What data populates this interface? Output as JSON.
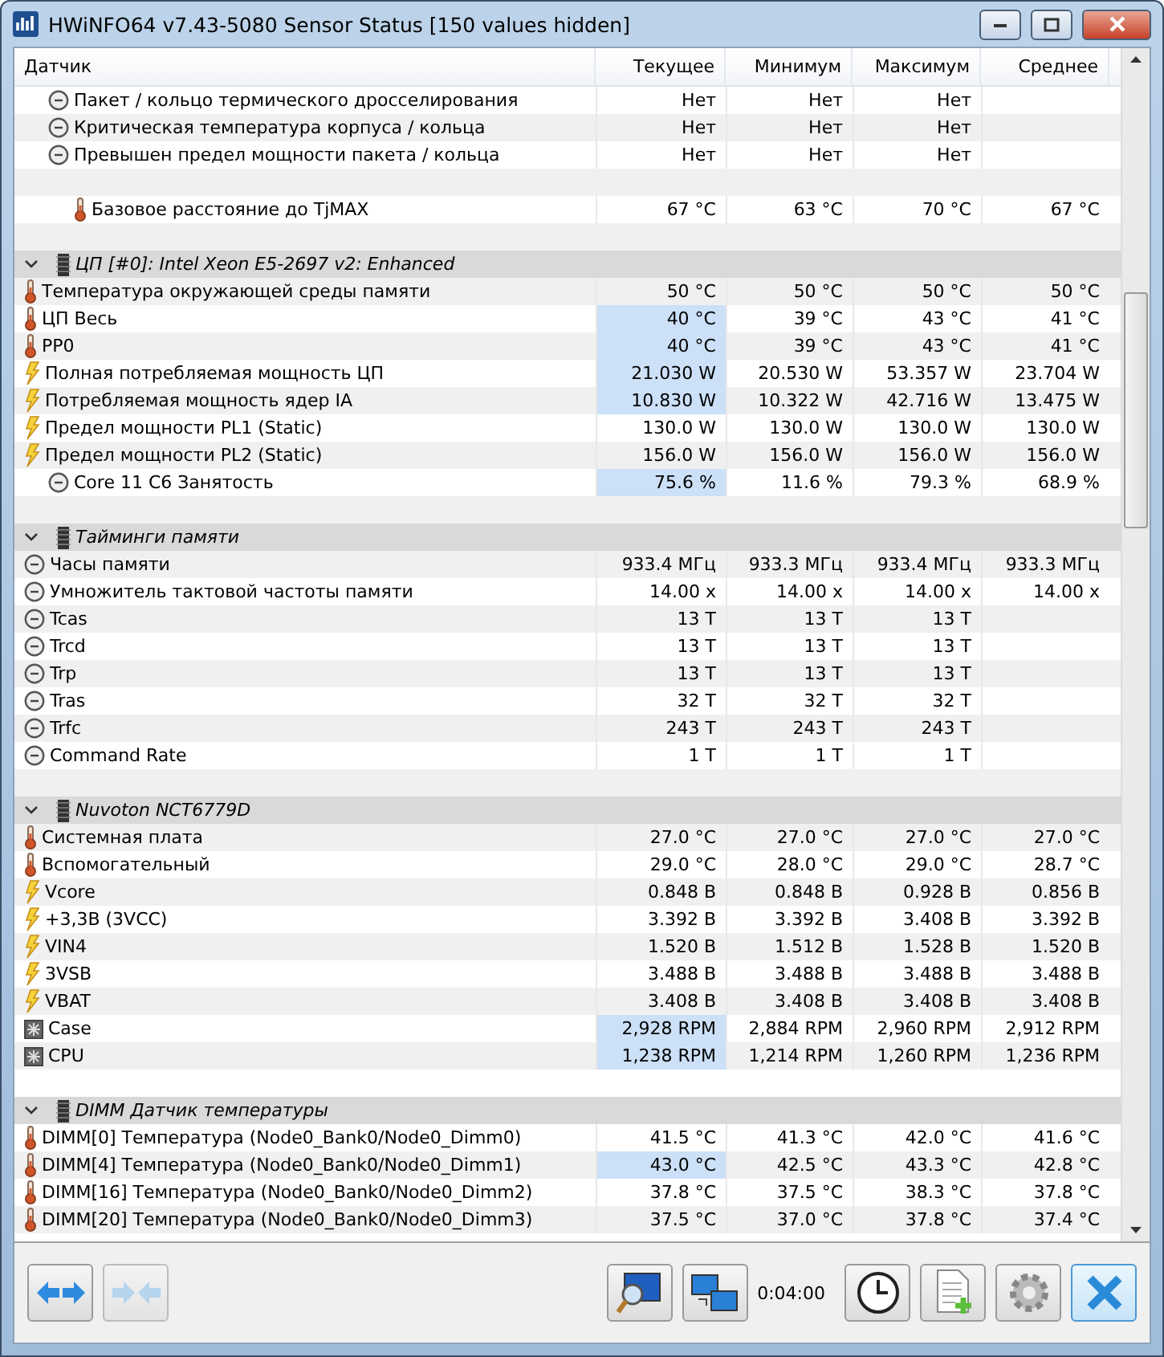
{
  "window": {
    "title": "HWiNFO64 v7.43-5080 Sensor Status [150 values hidden]"
  },
  "columns": [
    "Датчик",
    "Текущее",
    "Минимум",
    "Максимум",
    "Среднее"
  ],
  "rows": [
    {
      "kind": "clock",
      "indented": true,
      "label": "Пакет / кольцо термического дросселирования",
      "current": "Нет",
      "minimum": "Нет",
      "maximum": "Нет",
      "highlight": false
    },
    {
      "kind": "clock",
      "indented": true,
      "label": "Критическая температура корпуса / кольца",
      "current": "Нет",
      "minimum": "Нет",
      "maximum": "Нет",
      "highlight": false
    },
    {
      "kind": "clock",
      "indented": true,
      "label": "Превышен предел мощности пакета / кольца",
      "current": "Нет",
      "minimum": "Нет",
      "maximum": "Нет",
      "highlight": false
    },
    {
      "kind": "blank"
    },
    {
      "kind": "temperature",
      "indented": true,
      "label": "Базовое расстояние до TjMAX",
      "current": "67 °C",
      "minimum": "63 °C",
      "maximum": "70 °C",
      "average": "67 °C",
      "highlight": false
    },
    {
      "kind": "blank"
    },
    {
      "kind": "group",
      "label": "ЦП [#0]: Intel Xeon E5-2697 v2: Enhanced",
      "expanded": true
    },
    {
      "kind": "temperature",
      "indented": false,
      "label": "Температура окружающей среды памяти",
      "current": "50 °C",
      "minimum": "50 °C",
      "maximum": "50 °C",
      "average": "50 °C",
      "highlight": false
    },
    {
      "kind": "temperature",
      "indented": false,
      "label": "ЦП Весь",
      "current": "40 °C",
      "minimum": "39 °C",
      "maximum": "43 °C",
      "average": "41 °C",
      "highlight": true
    },
    {
      "kind": "temperature",
      "indented": false,
      "label": "PP0",
      "current": "40 °C",
      "minimum": "39 °C",
      "maximum": "43 °C",
      "average": "41 °C",
      "highlight": true
    },
    {
      "kind": "power",
      "indented": false,
      "label": "Полная потребляемая мощность ЦП",
      "current": "21.030 W",
      "minimum": "20.530 W",
      "maximum": "53.357 W",
      "average": "23.704 W",
      "highlight": true
    },
    {
      "kind": "power",
      "indented": false,
      "label": "Потребляемая мощность ядер IA",
      "current": "10.830 W",
      "minimum": "10.322 W",
      "maximum": "42.716 W",
      "average": "13.475 W",
      "highlight": true
    },
    {
      "kind": "power",
      "indented": false,
      "label": "Предел мощности PL1 (Static)",
      "current": "130.0 W",
      "minimum": "130.0 W",
      "maximum": "130.0 W",
      "average": "130.0 W",
      "highlight": false
    },
    {
      "kind": "power",
      "indented": false,
      "label": "Предел мощности PL2 (Static)",
      "current": "156.0 W",
      "minimum": "156.0 W",
      "maximum": "156.0 W",
      "average": "156.0 W",
      "highlight": false
    },
    {
      "kind": "clock",
      "indented": true,
      "label": "Core 11 C6 Занятость",
      "current": "75.6 %",
      "minimum": "11.6 %",
      "maximum": "79.3 %",
      "average": "68.9 %",
      "highlight": true
    },
    {
      "kind": "blank"
    },
    {
      "kind": "group",
      "label": "Тайминги памяти",
      "expanded": true
    },
    {
      "kind": "clock",
      "indented": false,
      "label": "Часы памяти",
      "current": "933.4 МГц",
      "minimum": "933.3 МГц",
      "maximum": "933.4 МГц",
      "average": "933.3 МГц",
      "highlight": false
    },
    {
      "kind": "clock",
      "indented": false,
      "label": "Умножитель тактовой частоты памяти",
      "current": "14.00 x",
      "minimum": "14.00 x",
      "maximum": "14.00 x",
      "average": "14.00 x",
      "highlight": false
    },
    {
      "kind": "clock",
      "indented": false,
      "label": "Tcas",
      "current": "13 T",
      "minimum": "13 T",
      "maximum": "13 T",
      "highlight": false
    },
    {
      "kind": "clock",
      "indented": false,
      "label": "Trcd",
      "current": "13 T",
      "minimum": "13 T",
      "maximum": "13 T",
      "highlight": false
    },
    {
      "kind": "clock",
      "indented": false,
      "label": "Trp",
      "current": "13 T",
      "minimum": "13 T",
      "maximum": "13 T",
      "highlight": false
    },
    {
      "kind": "clock",
      "indented": false,
      "label": "Tras",
      "current": "32 T",
      "minimum": "32 T",
      "maximum": "32 T",
      "highlight": false
    },
    {
      "kind": "clock",
      "indented": false,
      "label": "Trfc",
      "current": "243 T",
      "minimum": "243 T",
      "maximum": "243 T",
      "highlight": false
    },
    {
      "kind": "clock",
      "indented": false,
      "label": "Command Rate",
      "current": "1 T",
      "minimum": "1 T",
      "maximum": "1 T",
      "highlight": false
    },
    {
      "kind": "blank"
    },
    {
      "kind": "group",
      "label": "Nuvoton NCT6779D",
      "expanded": true
    },
    {
      "kind": "temperature",
      "indented": false,
      "label": "Системная плата",
      "current": "27.0 °C",
      "minimum": "27.0 °C",
      "maximum": "27.0 °C",
      "average": "27.0 °C",
      "highlight": false
    },
    {
      "kind": "temperature",
      "indented": false,
      "label": "Вспомогательный",
      "current": "29.0 °C",
      "minimum": "28.0 °C",
      "maximum": "29.0 °C",
      "average": "28.7 °C",
      "highlight": false
    },
    {
      "kind": "power",
      "indented": false,
      "label": "Vcore",
      "current": "0.848 В",
      "minimum": "0.848 В",
      "maximum": "0.928 В",
      "average": "0.856 В",
      "highlight": false
    },
    {
      "kind": "power",
      "indented": false,
      "label": "+3,3В (3VCC)",
      "current": "3.392 В",
      "minimum": "3.392 В",
      "maximum": "3.408 В",
      "average": "3.392 В",
      "highlight": false
    },
    {
      "kind": "power",
      "indented": false,
      "label": "VIN4",
      "current": "1.520 В",
      "minimum": "1.512 В",
      "maximum": "1.528 В",
      "average": "1.520 В",
      "highlight": false
    },
    {
      "kind": "power",
      "indented": false,
      "label": "3VSB",
      "current": "3.488 В",
      "minimum": "3.488 В",
      "maximum": "3.488 В",
      "average": "3.488 В",
      "highlight": false
    },
    {
      "kind": "power",
      "indented": false,
      "label": "VBAT",
      "current": "3.408 В",
      "minimum": "3.408 В",
      "maximum": "3.408 В",
      "average": "3.408 В",
      "highlight": false
    },
    {
      "kind": "fan",
      "indented": false,
      "label": "Case",
      "current": "2,928 RPM",
      "minimum": "2,884 RPM",
      "maximum": "2,960 RPM",
      "average": "2,912 RPM",
      "highlight": true
    },
    {
      "kind": "fan",
      "indented": false,
      "label": "CPU",
      "current": "1,238 RPM",
      "minimum": "1,214 RPM",
      "maximum": "1,260 RPM",
      "average": "1,236 RPM",
      "highlight": true
    },
    {
      "kind": "blank"
    },
    {
      "kind": "group",
      "label": "DIMM Датчик температуры",
      "expanded": true
    },
    {
      "kind": "temperature",
      "indented": false,
      "label": "DIMM[0] Температура (Node0_Bank0/Node0_Dimm0)",
      "current": "41.5 °C",
      "minimum": "41.3 °C",
      "maximum": "42.0 °C",
      "average": "41.6 °C",
      "highlight": false
    },
    {
      "kind": "temperature",
      "indented": false,
      "label": "DIMM[4] Температура (Node0_Bank0/Node0_Dimm1)",
      "current": "43.0 °C",
      "minimum": "42.5 °C",
      "maximum": "43.3 °C",
      "average": "42.8 °C",
      "highlight": true
    },
    {
      "kind": "temperature",
      "indented": false,
      "label": "DIMM[16] Температура (Node0_Bank0/Node0_Dimm2)",
      "current": "37.8 °C",
      "minimum": "37.5 °C",
      "maximum": "38.3 °C",
      "average": "37.8 °C",
      "highlight": false
    },
    {
      "kind": "temperature",
      "indented": false,
      "label": "DIMM[20] Температура (Node0_Bank0/Node0_Dimm3)",
      "current": "37.5 °C",
      "minimum": "37.0 °C",
      "maximum": "37.8 °C",
      "average": "37.4 °C",
      "highlight": false
    }
  ],
  "toolbar": {
    "timer": "0:04:00",
    "close_selected": true
  }
}
